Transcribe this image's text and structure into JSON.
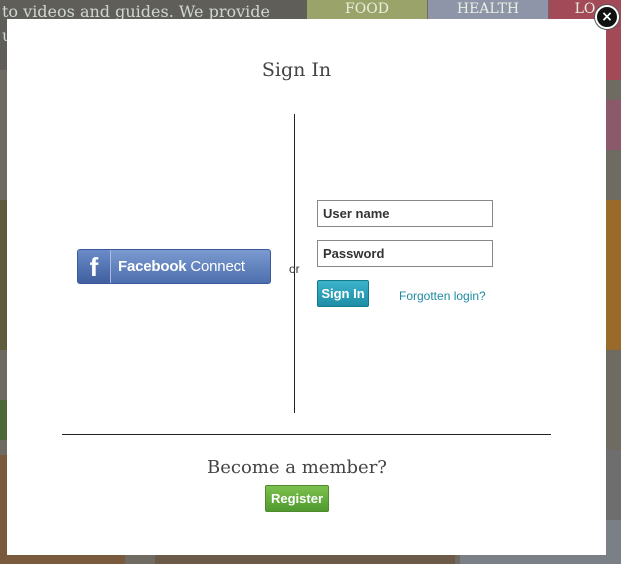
{
  "background": {
    "intro_text": "to videos and guides. We provide",
    "intro_text_2": "u",
    "nav": [
      "FOOD",
      "HEALTH",
      "LO"
    ]
  },
  "modal": {
    "title": "Sign In",
    "facebook": {
      "brand": "Facebook",
      "action": "Connect",
      "logo_letter": "f"
    },
    "separator": "or",
    "username_placeholder": "User name",
    "password_placeholder": "Password",
    "signin_label": "Sign In",
    "forgot_label": "Forgotten login?",
    "member_prompt": "Become a member?",
    "register_label": "Register",
    "close_symbol": "×"
  },
  "colors": {
    "accent_teal": "#1f8ea6",
    "register_green": "#4f9a30",
    "facebook_blue": "#4e6fae"
  }
}
